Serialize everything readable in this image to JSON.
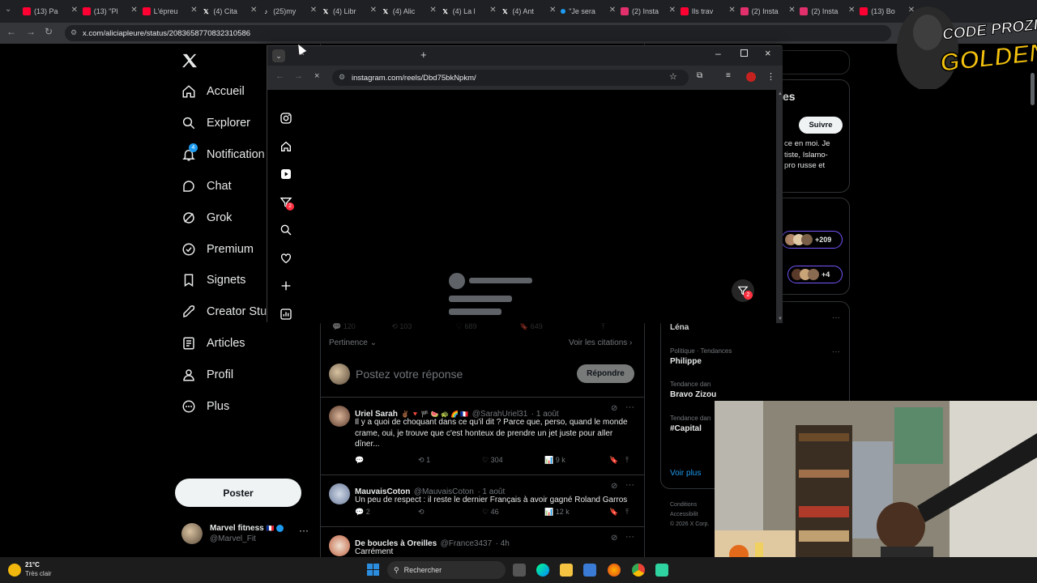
{
  "browser": {
    "tabs": [
      {
        "label": "(13) Pa",
        "icon": "youtube-icon",
        "color": "#ff0033"
      },
      {
        "label": "(13) \"Pl",
        "icon": "youtube-icon",
        "color": "#ff0033"
      },
      {
        "label": "L'épreu",
        "icon": "youtube-icon",
        "color": "#ff0033"
      },
      {
        "label": "(4) Cita",
        "icon": "x-icon",
        "color": "#ffffff"
      },
      {
        "label": "(25)my",
        "icon": "tiktok-icon",
        "color": "#ffffff"
      },
      {
        "label": "(4) Libr",
        "icon": "x-icon",
        "color": "#ffffff"
      },
      {
        "label": "(4) Alic",
        "icon": "x-icon",
        "color": "#ffffff"
      },
      {
        "label": "(4) La l",
        "icon": "x-icon",
        "color": "#ffffff"
      },
      {
        "label": "(4) Ant",
        "icon": "x-icon",
        "color": "#ffffff"
      },
      {
        "label": "\"Je sera",
        "icon": "dot-icon",
        "color": "#1d9bf0"
      },
      {
        "label": "(2) Insta",
        "icon": "instagram-icon",
        "color": "#e1306c"
      },
      {
        "label": "Ils trav",
        "icon": "youtube-icon",
        "color": "#ff0033"
      },
      {
        "label": "(2) Insta",
        "icon": "instagram-icon",
        "color": "#e1306c"
      },
      {
        "label": "(2) Insta",
        "icon": "instagram-icon",
        "color": "#e1306c"
      },
      {
        "label": "(13) Bo",
        "icon": "youtube-icon",
        "color": "#ff0033"
      }
    ],
    "url": "x.com/aliciapleure/status/2083658770832310586"
  },
  "nav": {
    "items": [
      {
        "label": "Accueil",
        "icon": "home-icon"
      },
      {
        "label": "Explorer",
        "icon": "search-icon"
      },
      {
        "label": "Notification",
        "icon": "bell-icon",
        "badge": "4"
      },
      {
        "label": "Chat",
        "icon": "chat-icon"
      },
      {
        "label": "Grok",
        "icon": "grok-icon"
      },
      {
        "label": "Premium",
        "icon": "verified-icon"
      },
      {
        "label": "Signets",
        "icon": "bookmark-icon"
      },
      {
        "label": "Creator Stud",
        "icon": "rocket-icon"
      },
      {
        "label": "Articles",
        "icon": "article-icon"
      },
      {
        "label": "Profil",
        "icon": "profile-icon"
      },
      {
        "label": "Plus",
        "icon": "more-icon"
      }
    ],
    "post_button": "Poster",
    "account": {
      "name": "Marvel fitness",
      "flag": "🇫🇷",
      "handle": "@Marvel_Fit"
    }
  },
  "thread": {
    "top_actions": {
      "replies": "120",
      "reposts": "103",
      "likes": "689",
      "bookmarks": "649"
    },
    "sort": "Pertinence",
    "quotes_link": "Voir les citations",
    "reply_placeholder": "Postez votre réponse",
    "reply_button": "Répondre",
    "replies": [
      {
        "name": "Uriel Sarah",
        "emojis": "✌🏾 🔻 🏴 🍉 🐢 🌈 🇫🇷",
        "handle": "@SarahUriel31",
        "time": "· 1 août",
        "text": "Il y a quoi de choquant dans ce qu'il dit ? Parce que, perso, quand le monde crame, oui, je trouve que c'est honteux de prendre un jet juste pour aller dîner...",
        "replies": "",
        "reposts": "1",
        "likes": "304",
        "views": "9 k"
      },
      {
        "name": "MauvaisCoton",
        "emojis": "",
        "handle": "@MauvaisCoton",
        "time": "· 1 août",
        "text": "Un peu de respect : il reste le dernier Français à avoir gagné Roland Garros",
        "replies": "2",
        "reposts": "",
        "likes": "46",
        "views": "12 k"
      },
      {
        "name": "De boucles à Oreilles",
        "emojis": "",
        "handle": "@France3437",
        "time": "· 4h",
        "text": "Carrément",
        "replies": "",
        "reposts": "",
        "likes": "",
        "views": ""
      }
    ]
  },
  "right": {
    "follow_button": "Suivre",
    "bio_fragments": [
      "ce en moi. Je",
      "tiste, Islamo-",
      "pro russe et"
    ],
    "heading_fragment": "es",
    "pill1": "+209",
    "pill2": "+4",
    "trends": [
      {
        "context": "Tendance dans la catégorie France",
        "name": "Léna"
      },
      {
        "context": "Politique · Tendances",
        "name": "Philippe"
      },
      {
        "context": "Tendance dan",
        "name": "Bravo Zizou"
      },
      {
        "context": "Tendance dan",
        "name": "#Capital"
      }
    ],
    "see_more": "Voir plus",
    "footer": [
      "Conditions",
      "Accessibilit",
      "© 2026 X Corp."
    ]
  },
  "popup": {
    "url": "instagram.com/reels/Dbd75bkNpkm/",
    "ig_nav": [
      {
        "icon": "instagram-icon"
      },
      {
        "icon": "home-icon"
      },
      {
        "icon": "reels-icon"
      },
      {
        "icon": "messages-icon",
        "badge": "2"
      },
      {
        "icon": "search-icon"
      },
      {
        "icon": "heart-icon"
      },
      {
        "icon": "plus-icon"
      },
      {
        "icon": "dashboard-icon"
      }
    ],
    "floating_badge": "2"
  },
  "overlay": {
    "logo_line1": "CODE PROZIS",
    "logo_line2": "GOLDENG"
  },
  "taskbar": {
    "temp": "21°C",
    "weather": "Très clair",
    "search": "Rechercher"
  }
}
